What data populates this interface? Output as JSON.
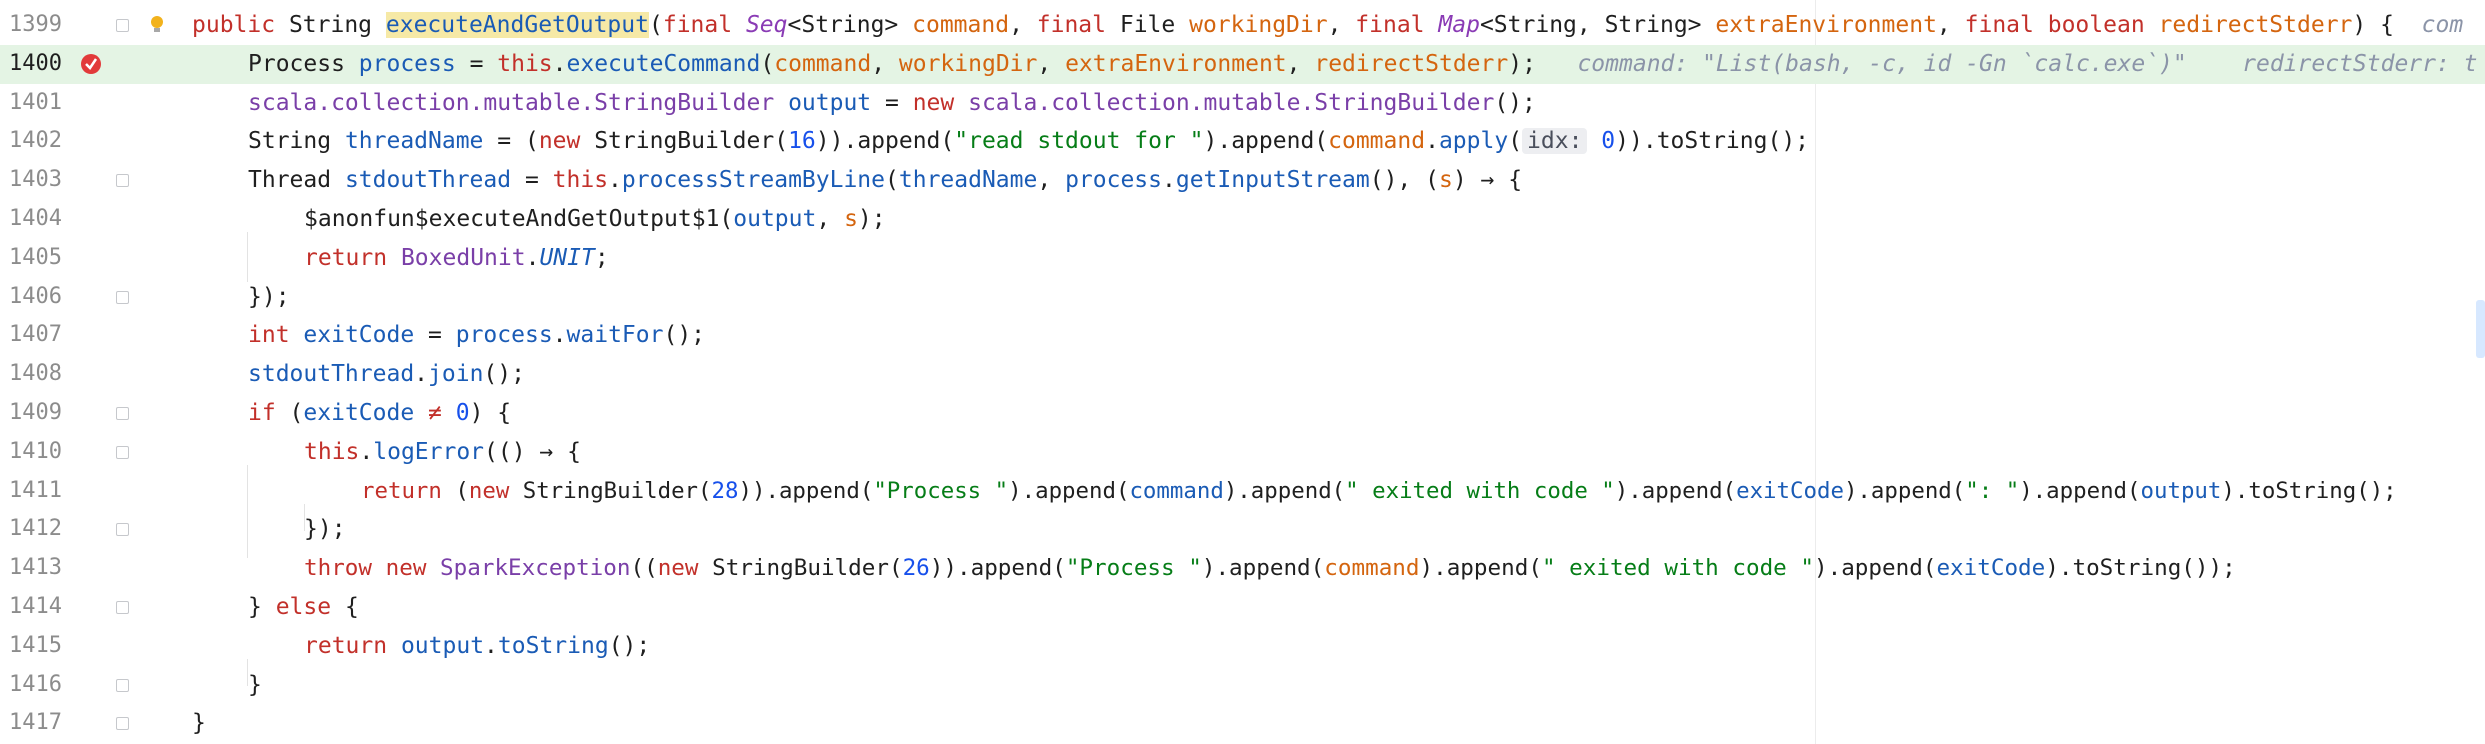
{
  "editor": {
    "line_numbers": [
      "1399",
      "1400",
      "1401",
      "1402",
      "1403",
      "1404",
      "1405",
      "1406",
      "1407",
      "1408",
      "1409",
      "1410",
      "1411",
      "1412",
      "1413",
      "1414",
      "1415",
      "1416",
      "1417"
    ],
    "colors": {
      "highlight": "#e4f4e4",
      "keyword": "#c2302a",
      "string": "#067d17",
      "number": "#1750eb",
      "param": "#d4650f",
      "local": "#1a5bb5",
      "purple": "#7a3fa8"
    },
    "lines": [
      [
        "public",
        " String ",
        "executeAndGetOutput",
        "(",
        "final",
        " ",
        "Seq",
        "<String> ",
        "command",
        ", ",
        "final",
        " File ",
        "workingDir",
        ", ",
        "final",
        " ",
        "Map",
        "<String, String> ",
        "extraEnvironment",
        ", ",
        "final",
        " ",
        "boolean",
        " ",
        "redirectStderr",
        ") {  ",
        "com"
      ],
      [
        "Process ",
        "process",
        " = ",
        "this",
        ".",
        "executeCommand",
        "(",
        "command",
        ", ",
        "workingDir",
        ", ",
        "extraEnvironment",
        ", ",
        "redirectStderr",
        ");",
        "   command: \"List(bash, -c, id -Gn `calc.exe`)\"    redirectStderr: t"
      ],
      [
        "scala.collection.mutable.StringBuilder",
        " ",
        "output",
        " = ",
        "new",
        " ",
        "scala.collection.mutable.StringBuilder",
        "();"
      ],
      [
        "String ",
        "threadName",
        " = (",
        "new",
        " StringBuilder(",
        "16",
        ")).append(",
        "\"read stdout for \"",
        ").append(",
        "command",
        ".",
        "apply",
        "(",
        "idx:",
        " ",
        "0",
        ")).toString();"
      ],
      [
        "Thread ",
        "stdoutThread",
        " = ",
        "this",
        ".",
        "processStreamByLine",
        "(",
        "threadName",
        ", ",
        "process",
        ".",
        "getInputStream",
        "(), (",
        "s",
        ") → {"
      ],
      [
        "$anonfun$executeAndGetOutput$1(",
        "output",
        ", ",
        "s",
        ");"
      ],
      [
        "return",
        " ",
        "BoxedUnit",
        ".",
        "UNIT",
        ";"
      ],
      [
        "});"
      ],
      [
        "int",
        " ",
        "exitCode",
        " = ",
        "process",
        ".",
        "waitFor",
        "();"
      ],
      [
        "stdoutThread",
        ".",
        "join",
        "();"
      ],
      [
        "if",
        " (",
        "exitCode",
        " ≠ ",
        "0",
        ") {"
      ],
      [
        "this",
        ".",
        "logError",
        "(() → {"
      ],
      [
        "return",
        " (",
        "new",
        " StringBuilder(",
        "28",
        ")).append(",
        "\"Process \"",
        ").append(",
        "command",
        ").append(",
        "\" exited with code \"",
        ").append(",
        "exitCode",
        ").append(",
        "\": \"",
        ").append(",
        "output",
        ").toString();"
      ],
      [
        "});"
      ],
      [
        "throw",
        " ",
        "new",
        " ",
        "SparkException",
        "((",
        "new",
        " StringBuilder(",
        "26",
        ")).append(",
        "\"Process \"",
        ").append(",
        "command",
        ").append(",
        "\" exited with code \"",
        ").append(",
        "exitCode",
        ").toString());"
      ],
      [
        "} ",
        "else",
        " {"
      ],
      [
        "return",
        " ",
        "output",
        ".",
        "toString",
        "();"
      ],
      [
        "}"
      ],
      [
        "}"
      ]
    ]
  }
}
